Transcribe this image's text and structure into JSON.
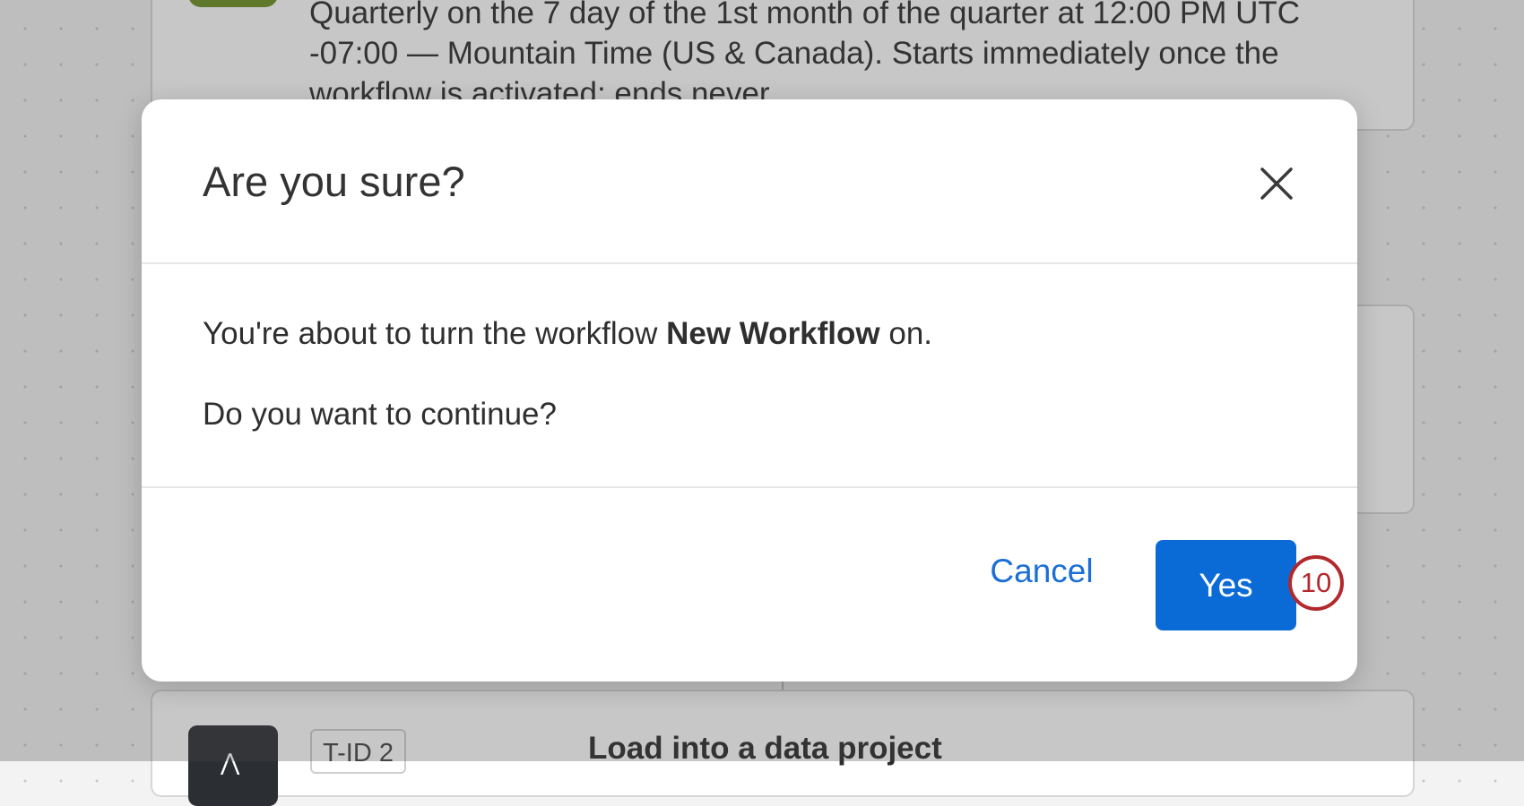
{
  "background": {
    "schedule_description": "Quarterly on the 7 day of the 1st month of the quarter at 12:00 PM UTC -07:00 — Mountain Time (US & Canada). Starts immediately once the workflow is activated; ends never",
    "task": {
      "tid": "T-ID 2",
      "title": "Load into a data project"
    }
  },
  "dialog": {
    "title": "Are you sure?",
    "message_prefix": "You're about to turn the workflow ",
    "workflow_name": "New Workflow",
    "message_suffix": " on.",
    "question": "Do you want to continue?",
    "cancel_label": "Cancel",
    "yes_label": "Yes",
    "close_icon": "close-icon"
  },
  "annotation": {
    "step_number": "10"
  },
  "colors": {
    "primary": "#0b6bd6",
    "link": "#1a6fd6",
    "annotation": "#b3282d",
    "task_badge": "#6a8e1f"
  }
}
